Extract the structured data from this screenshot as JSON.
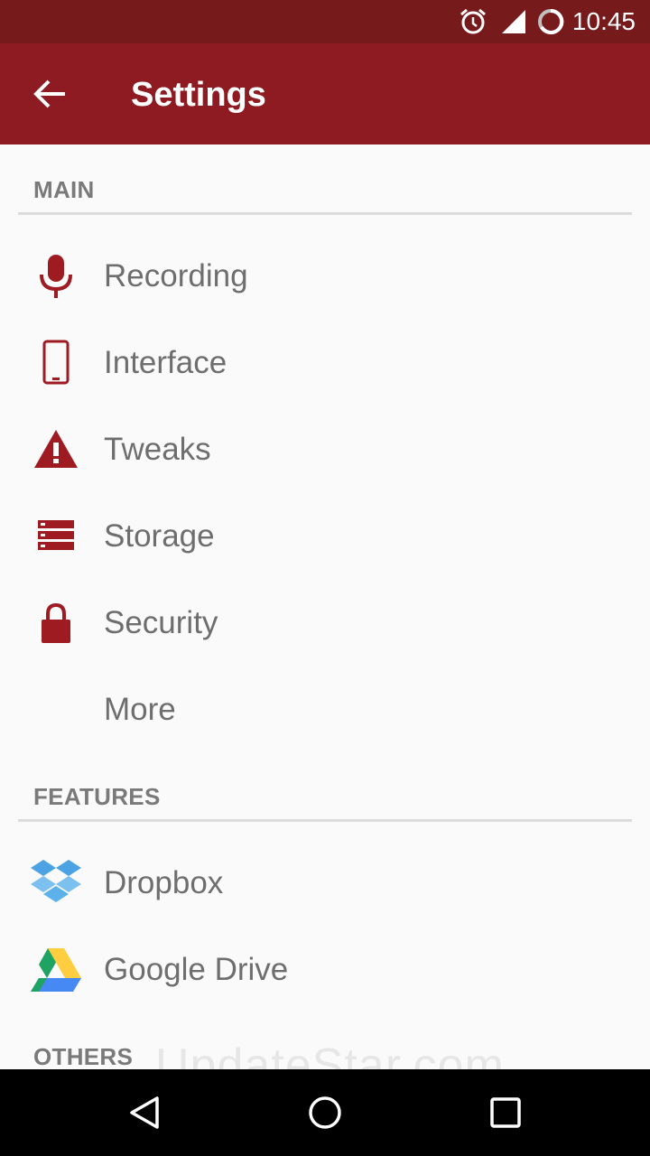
{
  "status_bar": {
    "time": "10:45",
    "icons": [
      "alarm-icon",
      "signal-icon",
      "battery-loading-icon"
    ]
  },
  "app_bar": {
    "title": "Settings",
    "back_icon": "arrow-left-icon"
  },
  "sections": {
    "main": {
      "header": "MAIN",
      "items": [
        {
          "label": "Recording",
          "icon": "microphone-icon"
        },
        {
          "label": "Interface",
          "icon": "phone-icon"
        },
        {
          "label": "Tweaks",
          "icon": "warning-icon"
        },
        {
          "label": "Storage",
          "icon": "storage-icon"
        },
        {
          "label": "Security",
          "icon": "lock-icon"
        },
        {
          "label": "More",
          "icon": ""
        }
      ]
    },
    "features": {
      "header": "FEATURES",
      "items": [
        {
          "label": "Dropbox",
          "icon": "dropbox-icon"
        },
        {
          "label": "Google Drive",
          "icon": "google-drive-icon"
        }
      ]
    },
    "others": {
      "header": "OTHERS"
    }
  },
  "watermark": "UpdateStar.com",
  "colors": {
    "accent": "#8f1b22",
    "status_bar": "#761a1c",
    "icon": "#9e1b22",
    "text": "#6e6e6e"
  },
  "nav_bar": {
    "icons": [
      "back-triangle-icon",
      "home-circle-icon",
      "recents-square-icon"
    ]
  }
}
